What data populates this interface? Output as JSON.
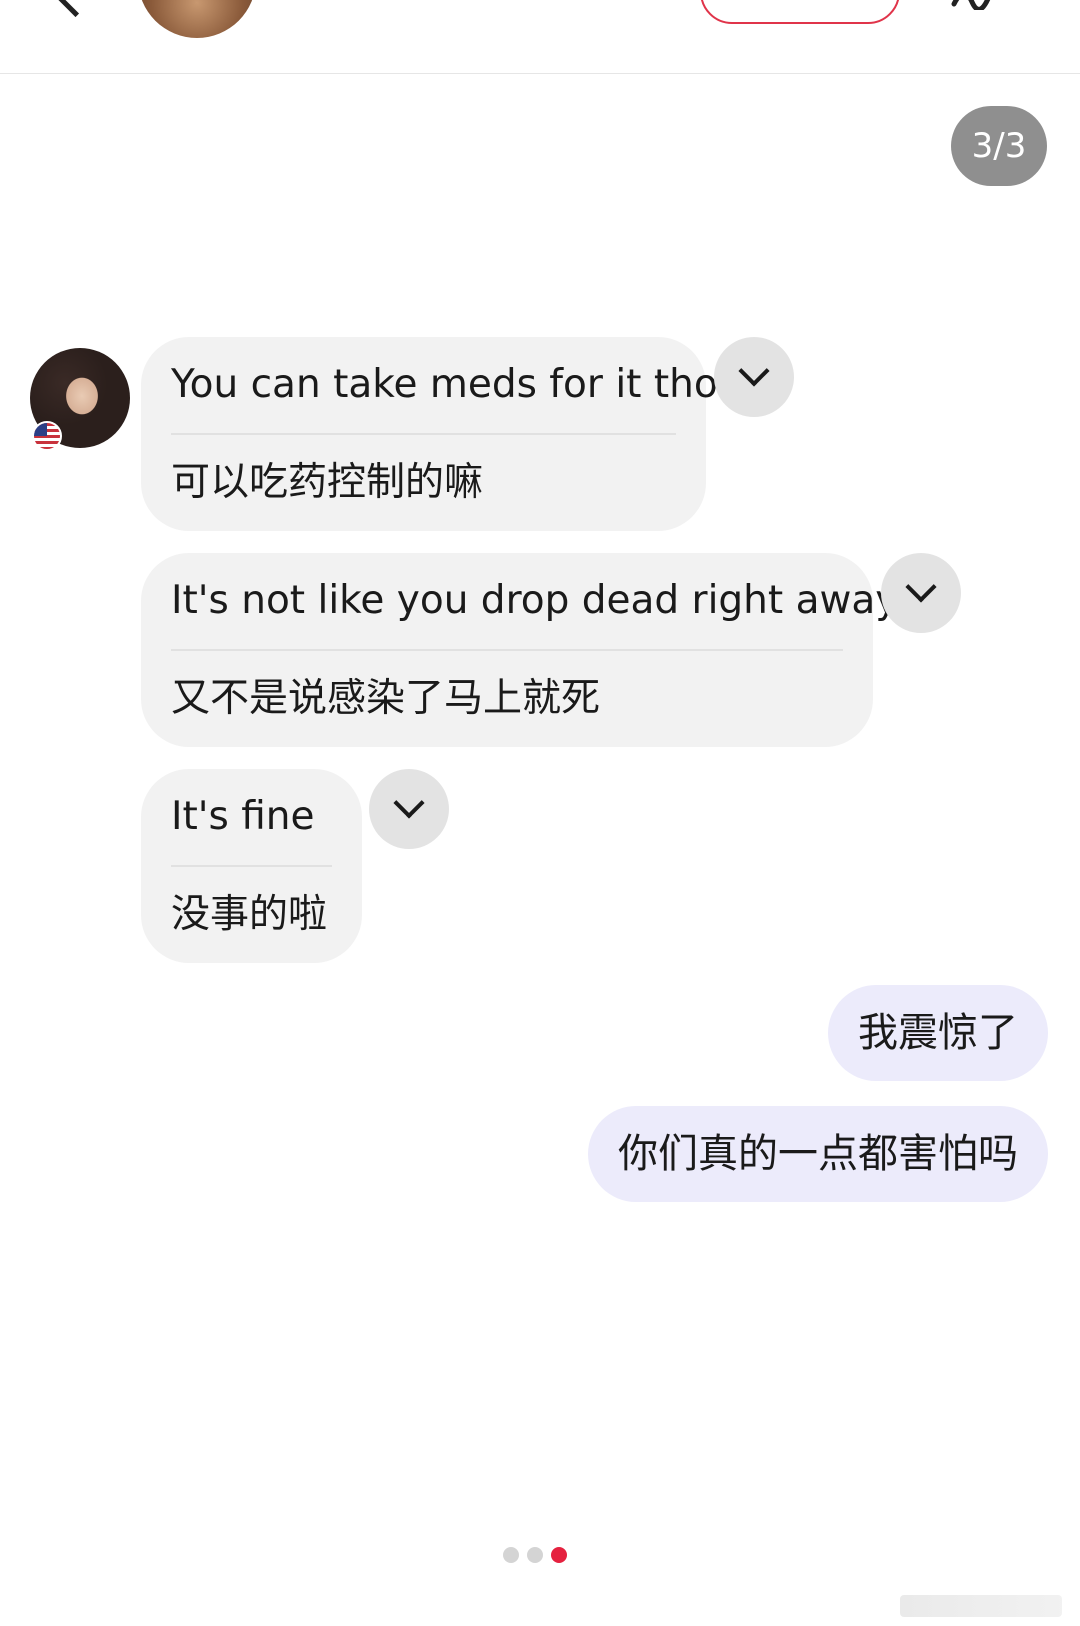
{
  "header": {
    "back_icon": "chevron-left-icon",
    "contact_name": "",
    "follow_label": "",
    "menu_icon": "signature-icon"
  },
  "page_indicator": {
    "text": "3/3"
  },
  "peer": {
    "country_flag": "us-flag-icon"
  },
  "messages_in": [
    {
      "original": "You can take meds for it tho",
      "translation": "可以吃药控制的嘛",
      "toggle_icon": "chevron-down-icon"
    },
    {
      "original": "It's not like you drop dead right away",
      "translation": "又不是说感染了马上就死",
      "toggle_icon": "chevron-down-icon"
    },
    {
      "original": "It's fine",
      "translation": "没事的啦",
      "toggle_icon": "chevron-down-icon"
    }
  ],
  "messages_out": [
    {
      "text": "我震惊了"
    },
    {
      "text": "你们真的一点都害怕吗"
    }
  ],
  "pager": {
    "total": 3,
    "active_index": 2,
    "active_color": "#e5213f"
  },
  "colors": {
    "incoming_bubble": "#f2f2f2",
    "outgoing_bubble": "#ecebfb",
    "page_badge": "#8f8f8f",
    "accent": "#e5213f"
  }
}
